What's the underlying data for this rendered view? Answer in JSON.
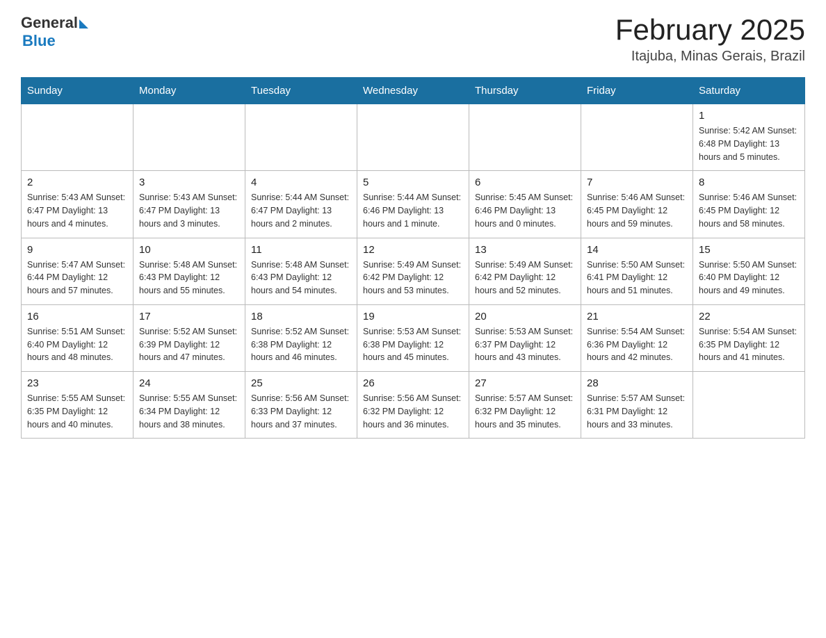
{
  "header": {
    "logo_general": "General",
    "logo_blue": "Blue",
    "title": "February 2025",
    "subtitle": "Itajuba, Minas Gerais, Brazil"
  },
  "calendar": {
    "days_of_week": [
      "Sunday",
      "Monday",
      "Tuesday",
      "Wednesday",
      "Thursday",
      "Friday",
      "Saturday"
    ],
    "weeks": [
      [
        {
          "day": "",
          "info": ""
        },
        {
          "day": "",
          "info": ""
        },
        {
          "day": "",
          "info": ""
        },
        {
          "day": "",
          "info": ""
        },
        {
          "day": "",
          "info": ""
        },
        {
          "day": "",
          "info": ""
        },
        {
          "day": "1",
          "info": "Sunrise: 5:42 AM\nSunset: 6:48 PM\nDaylight: 13 hours and 5 minutes."
        }
      ],
      [
        {
          "day": "2",
          "info": "Sunrise: 5:43 AM\nSunset: 6:47 PM\nDaylight: 13 hours and 4 minutes."
        },
        {
          "day": "3",
          "info": "Sunrise: 5:43 AM\nSunset: 6:47 PM\nDaylight: 13 hours and 3 minutes."
        },
        {
          "day": "4",
          "info": "Sunrise: 5:44 AM\nSunset: 6:47 PM\nDaylight: 13 hours and 2 minutes."
        },
        {
          "day": "5",
          "info": "Sunrise: 5:44 AM\nSunset: 6:46 PM\nDaylight: 13 hours and 1 minute."
        },
        {
          "day": "6",
          "info": "Sunrise: 5:45 AM\nSunset: 6:46 PM\nDaylight: 13 hours and 0 minutes."
        },
        {
          "day": "7",
          "info": "Sunrise: 5:46 AM\nSunset: 6:45 PM\nDaylight: 12 hours and 59 minutes."
        },
        {
          "day": "8",
          "info": "Sunrise: 5:46 AM\nSunset: 6:45 PM\nDaylight: 12 hours and 58 minutes."
        }
      ],
      [
        {
          "day": "9",
          "info": "Sunrise: 5:47 AM\nSunset: 6:44 PM\nDaylight: 12 hours and 57 minutes."
        },
        {
          "day": "10",
          "info": "Sunrise: 5:48 AM\nSunset: 6:43 PM\nDaylight: 12 hours and 55 minutes."
        },
        {
          "day": "11",
          "info": "Sunrise: 5:48 AM\nSunset: 6:43 PM\nDaylight: 12 hours and 54 minutes."
        },
        {
          "day": "12",
          "info": "Sunrise: 5:49 AM\nSunset: 6:42 PM\nDaylight: 12 hours and 53 minutes."
        },
        {
          "day": "13",
          "info": "Sunrise: 5:49 AM\nSunset: 6:42 PM\nDaylight: 12 hours and 52 minutes."
        },
        {
          "day": "14",
          "info": "Sunrise: 5:50 AM\nSunset: 6:41 PM\nDaylight: 12 hours and 51 minutes."
        },
        {
          "day": "15",
          "info": "Sunrise: 5:50 AM\nSunset: 6:40 PM\nDaylight: 12 hours and 49 minutes."
        }
      ],
      [
        {
          "day": "16",
          "info": "Sunrise: 5:51 AM\nSunset: 6:40 PM\nDaylight: 12 hours and 48 minutes."
        },
        {
          "day": "17",
          "info": "Sunrise: 5:52 AM\nSunset: 6:39 PM\nDaylight: 12 hours and 47 minutes."
        },
        {
          "day": "18",
          "info": "Sunrise: 5:52 AM\nSunset: 6:38 PM\nDaylight: 12 hours and 46 minutes."
        },
        {
          "day": "19",
          "info": "Sunrise: 5:53 AM\nSunset: 6:38 PM\nDaylight: 12 hours and 45 minutes."
        },
        {
          "day": "20",
          "info": "Sunrise: 5:53 AM\nSunset: 6:37 PM\nDaylight: 12 hours and 43 minutes."
        },
        {
          "day": "21",
          "info": "Sunrise: 5:54 AM\nSunset: 6:36 PM\nDaylight: 12 hours and 42 minutes."
        },
        {
          "day": "22",
          "info": "Sunrise: 5:54 AM\nSunset: 6:35 PM\nDaylight: 12 hours and 41 minutes."
        }
      ],
      [
        {
          "day": "23",
          "info": "Sunrise: 5:55 AM\nSunset: 6:35 PM\nDaylight: 12 hours and 40 minutes."
        },
        {
          "day": "24",
          "info": "Sunrise: 5:55 AM\nSunset: 6:34 PM\nDaylight: 12 hours and 38 minutes."
        },
        {
          "day": "25",
          "info": "Sunrise: 5:56 AM\nSunset: 6:33 PM\nDaylight: 12 hours and 37 minutes."
        },
        {
          "day": "26",
          "info": "Sunrise: 5:56 AM\nSunset: 6:32 PM\nDaylight: 12 hours and 36 minutes."
        },
        {
          "day": "27",
          "info": "Sunrise: 5:57 AM\nSunset: 6:32 PM\nDaylight: 12 hours and 35 minutes."
        },
        {
          "day": "28",
          "info": "Sunrise: 5:57 AM\nSunset: 6:31 PM\nDaylight: 12 hours and 33 minutes."
        },
        {
          "day": "",
          "info": ""
        }
      ]
    ]
  }
}
